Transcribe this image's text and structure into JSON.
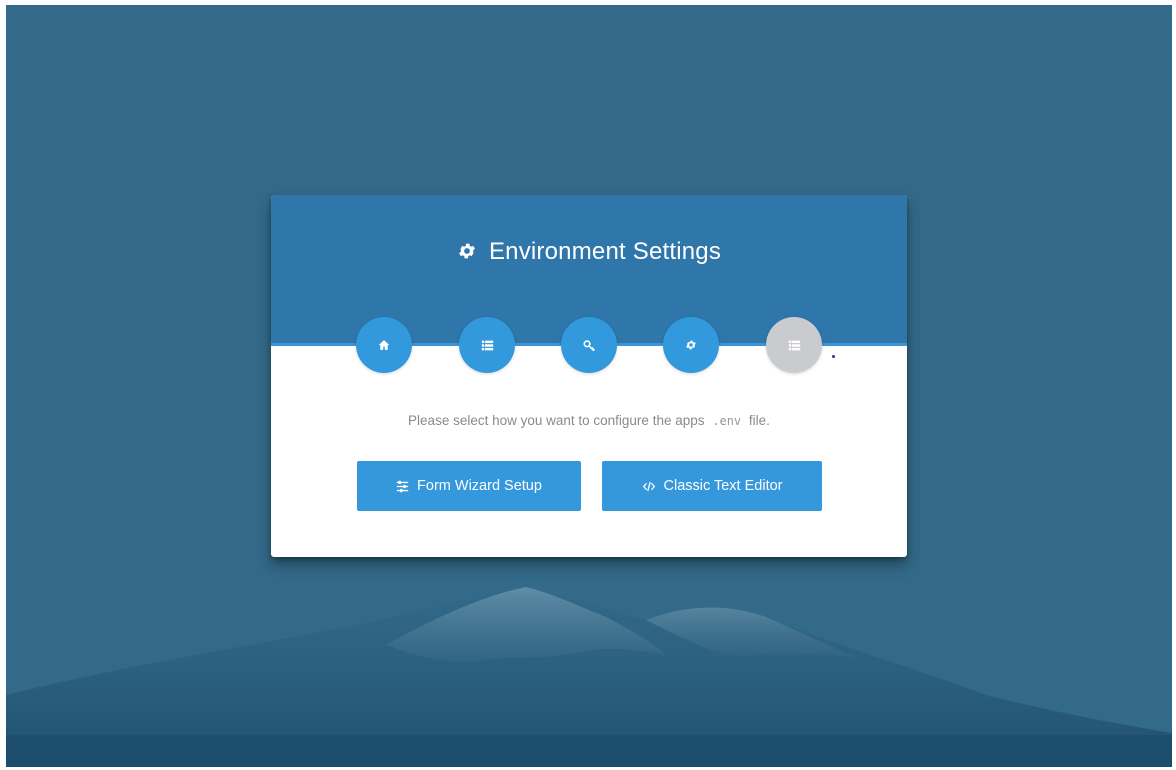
{
  "page": {
    "title": "Environment Settings",
    "title_icon": "gear-icon",
    "colors": {
      "background": "#336a89",
      "header": "#2f76ab",
      "accent": "#3598dc",
      "inactive_step": "#c9cbcf"
    }
  },
  "steps": [
    {
      "icon": "home-icon",
      "state": "active"
    },
    {
      "icon": "list-icon",
      "state": "active"
    },
    {
      "icon": "key-icon",
      "state": "active"
    },
    {
      "icon": "gear-icon",
      "state": "active"
    },
    {
      "icon": "list-icon",
      "state": "inactive"
    }
  ],
  "content": {
    "description_before": "Please select how you want to configure the apps",
    "description_code": ".env",
    "description_after": "file."
  },
  "buttons": {
    "wizard": {
      "label": "Form Wizard Setup",
      "icon": "sliders-icon"
    },
    "editor": {
      "label": "Classic Text Editor",
      "icon": "code-icon"
    }
  }
}
